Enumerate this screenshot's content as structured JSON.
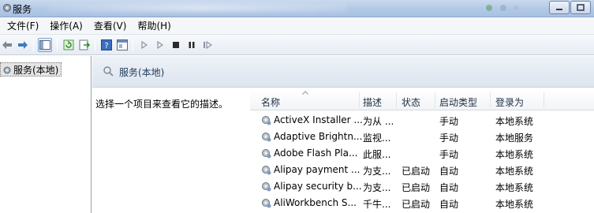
{
  "window": {
    "title": "服务"
  },
  "menu": [
    "文件(F)",
    "操作(A)",
    "查看(V)",
    "帮助(H)"
  ],
  "tree": {
    "selected_label": "服务(本地)"
  },
  "pane": {
    "header_title": "服务(本地)",
    "description": "选择一个项目来查看它的描述。"
  },
  "table": {
    "columns": [
      "名称",
      "描述",
      "状态",
      "启动类型",
      "登录为"
    ],
    "rows": [
      {
        "name": "ActiveX Installer ...",
        "desc": "为从 ...",
        "status": "",
        "startup": "手动",
        "logon": "本地系统"
      },
      {
        "name": "Adaptive Brightn...",
        "desc": "监视...",
        "status": "",
        "startup": "手动",
        "logon": "本地服务"
      },
      {
        "name": "Adobe Flash Pla...",
        "desc": "此服...",
        "status": "",
        "startup": "手动",
        "logon": "本地系统"
      },
      {
        "name": "Alipay payment ...",
        "desc": "为支...",
        "status": "已启动",
        "startup": "自动",
        "logon": "本地系统"
      },
      {
        "name": "Alipay security b...",
        "desc": "为支...",
        "status": "已启动",
        "startup": "自动",
        "logon": "本地系统"
      },
      {
        "name": "AliWorkbench S...",
        "desc": "千牛...",
        "status": "已启动",
        "startup": "自动",
        "logon": "本地系统"
      }
    ]
  },
  "toolbar_icons": [
    "back-arrow-icon",
    "forward-arrow-icon",
    "show-tree-icon",
    "refresh-icon",
    "export-icon",
    "help-icon",
    "properties-icon",
    "start-icon",
    "start-alt-icon",
    "stop-icon",
    "pause-icon",
    "resume-icon"
  ],
  "colors": {
    "title_gradient_top": "#c9d9ee",
    "header_text": "#1e395b",
    "tree_selection": "#e4e4e4"
  }
}
